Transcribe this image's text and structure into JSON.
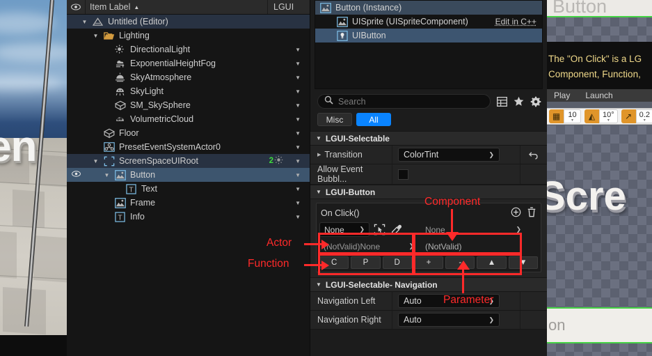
{
  "outliner": {
    "header": {
      "eye_icon": "eye-icon",
      "label": "Item Label",
      "sort_caret": "▲",
      "right_column": "LGUI"
    },
    "rows": [
      {
        "label": "Untitled (Editor)",
        "indent": 20,
        "icon": "level-icon",
        "tri": "▼",
        "state": "soft",
        "eye": false,
        "caret": false,
        "badge": null
      },
      {
        "label": "Lighting",
        "indent": 36,
        "icon": "folder-icon",
        "tri": "▼",
        "state": "none",
        "eye": false,
        "caret": false,
        "badge": null
      },
      {
        "label": "DirectionalLight",
        "indent": 52,
        "icon": "directional-light-icon",
        "tri": "",
        "state": "none",
        "eye": false,
        "caret": true,
        "badge": null
      },
      {
        "label": "ExponentialHeightFog",
        "indent": 52,
        "icon": "fog-icon",
        "tri": "",
        "state": "none",
        "eye": false,
        "caret": true,
        "badge": null
      },
      {
        "label": "SkyAtmosphere",
        "indent": 52,
        "icon": "sky-atmosphere-icon",
        "tri": "",
        "state": "none",
        "eye": false,
        "caret": true,
        "badge": null
      },
      {
        "label": "SkyLight",
        "indent": 52,
        "icon": "sky-light-icon",
        "tri": "",
        "state": "none",
        "eye": false,
        "caret": true,
        "badge": null
      },
      {
        "label": "SM_SkySphere",
        "indent": 52,
        "icon": "static-mesh-icon",
        "tri": "",
        "state": "none",
        "eye": false,
        "caret": true,
        "badge": null
      },
      {
        "label": "VolumetricCloud",
        "indent": 52,
        "icon": "cloud-icon",
        "tri": "",
        "state": "none",
        "eye": false,
        "caret": true,
        "badge": null
      },
      {
        "label": "Floor",
        "indent": 36,
        "icon": "static-mesh-icon",
        "tri": "",
        "state": "none",
        "eye": false,
        "caret": true,
        "badge": null
      },
      {
        "label": "PresetEventSystemActor0",
        "indent": 36,
        "icon": "actor-icon",
        "tri": "",
        "state": "none",
        "eye": false,
        "caret": true,
        "badge": null
      },
      {
        "label": "ScreenSpaceUIRoot",
        "indent": 36,
        "icon": "ui-root-icon",
        "tri": "▼",
        "state": "soft",
        "eye": false,
        "caret": true,
        "badge": "2"
      },
      {
        "label": "Button",
        "indent": 52,
        "icon": "ui-sprite-icon",
        "tri": "▼",
        "state": "strong",
        "eye": true,
        "caret": true,
        "badge": null
      },
      {
        "label": "Text",
        "indent": 68,
        "icon": "ui-text-icon",
        "tri": "",
        "state": "none",
        "eye": false,
        "caret": true,
        "badge": null
      },
      {
        "label": "Frame",
        "indent": 52,
        "icon": "ui-sprite-icon",
        "tri": "",
        "state": "none",
        "eye": false,
        "caret": true,
        "badge": null
      },
      {
        "label": "Info",
        "indent": 52,
        "icon": "ui-text-icon",
        "tri": "",
        "state": "none",
        "eye": false,
        "caret": true,
        "badge": null
      }
    ]
  },
  "details": {
    "component_tree": [
      {
        "label": "Button (Instance)",
        "icon": "ui-sprite-icon",
        "depth": 0,
        "state": "head",
        "action": null
      },
      {
        "label": "UISprite (UISpriteComponent)",
        "icon": "ui-sprite-icon",
        "depth": 1,
        "state": "none",
        "action": "Edit in C++"
      },
      {
        "label": "UIButton",
        "icon": "ui-button-icon",
        "depth": 1,
        "state": "sel",
        "action": null
      }
    ],
    "search": {
      "placeholder": "Search",
      "icon": "search-icon"
    },
    "header_icons": [
      "table-icon",
      "star-icon",
      "gear-icon"
    ],
    "filters": [
      {
        "label": "Misc",
        "active": false
      },
      {
        "label": "All",
        "active": true
      }
    ],
    "accent_blue": "#0a84ff",
    "annotation_red": "#ff2a2a",
    "categories": [
      {
        "title": "LGUI-Selectable",
        "rows": [
          {
            "name": "Transition",
            "expandable": true,
            "control": "combo",
            "value": "ColorTint",
            "revert": "revert-icon"
          },
          {
            "name": "Allow Event Bubbl...",
            "expandable": false,
            "control": "checkbox",
            "value": "",
            "revert": null
          }
        ]
      }
    ],
    "lgui_button": {
      "title": "LGUI-Button",
      "event_title": "On Click()",
      "add_icon": "plus-circle-icon",
      "delete_icon": "trash-icon",
      "actor_value": "None",
      "component_value": "None",
      "function_value": "(NotValid)None",
      "parameter_value": "(NotValid)",
      "pick_icons": [
        "select-actor-icon",
        "eyedropper-icon"
      ],
      "buttons": [
        "C",
        "P",
        "D",
        "+",
        "-",
        "▲",
        "▼"
      ]
    },
    "navigation": {
      "title": "LGUI-Selectable- Navigation",
      "rows": [
        {
          "name": "Navigation Left",
          "value": "Auto"
        },
        {
          "name": "Navigation Right",
          "value": "Auto"
        }
      ]
    }
  },
  "annotations": [
    {
      "label": "Component",
      "target": "component-dropdown"
    },
    {
      "label": "Actor",
      "target": "actor-dropdown"
    },
    {
      "label": "Function",
      "target": "function-dropdown"
    },
    {
      "label": "Parameter",
      "target": "parameter-field"
    }
  ],
  "viewport_left": {
    "text_3d": "en"
  },
  "viewport_right": {
    "button_label": "Button",
    "tooltip_line1": "The \"On Click\" is a LG",
    "tooltip_line2": "Component, Function,",
    "menu": [
      "Play",
      "Launch"
    ],
    "toolbar": [
      {
        "icon": "grid-snap-icon",
        "value": "10"
      },
      {
        "icon": "angle-snap-icon",
        "value": "10°"
      },
      {
        "icon": "scale-snap-icon",
        "value": "0.2"
      }
    ],
    "text_3d": "Scre",
    "field_text": "on"
  }
}
